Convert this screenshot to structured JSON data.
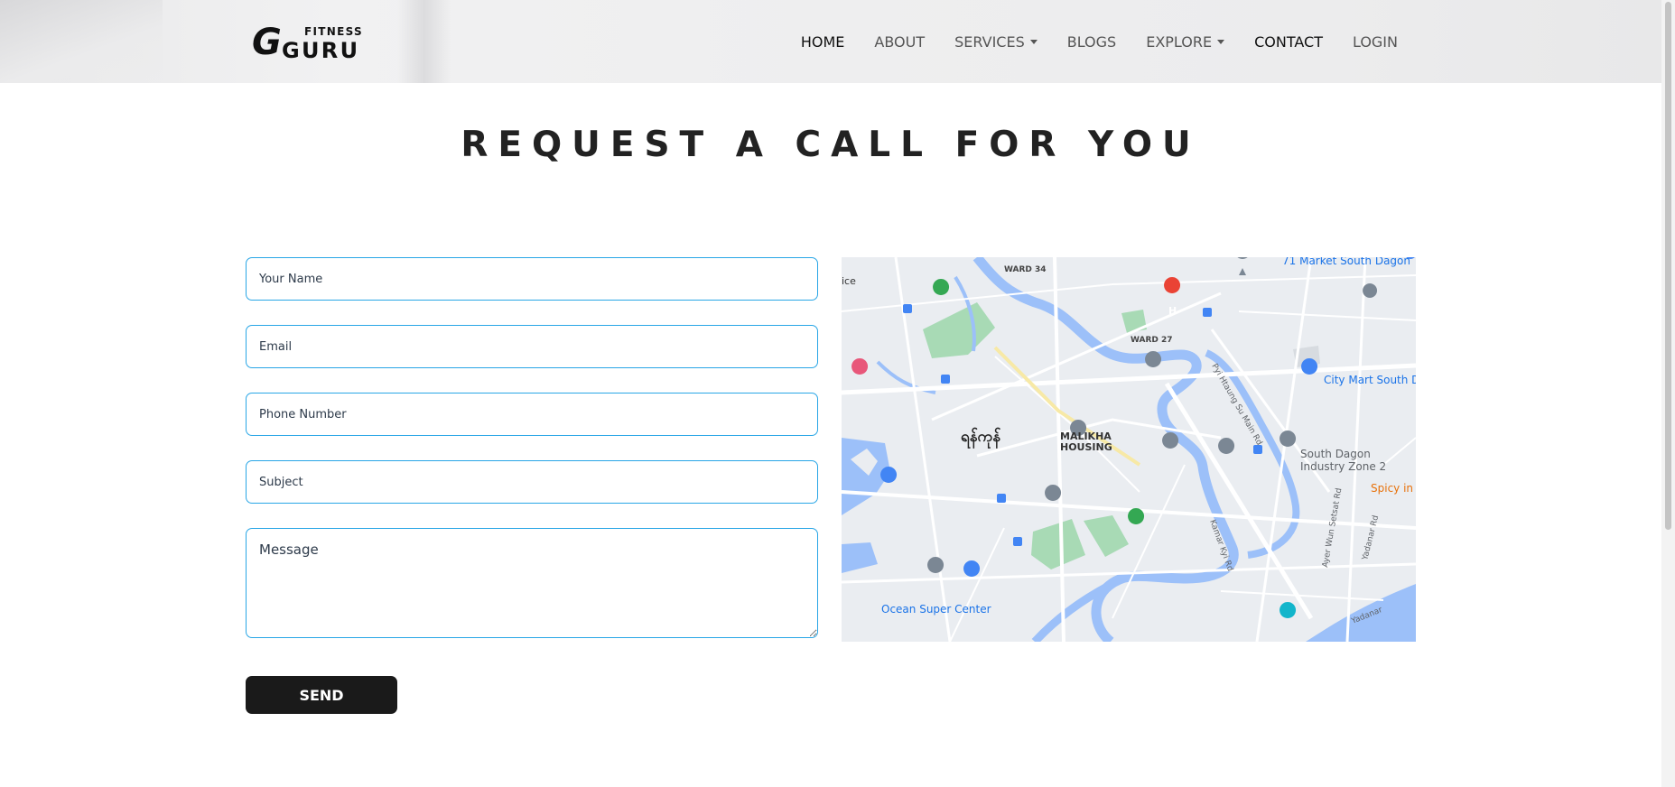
{
  "brand": {
    "logo_big": "GURU",
    "logo_small": "FITNESS"
  },
  "nav": {
    "items": [
      {
        "label": "HOME"
      },
      {
        "label": "ABOUT"
      },
      {
        "label": "SERVICES"
      },
      {
        "label": "BLOGS"
      },
      {
        "label": "EXPLORE"
      },
      {
        "label": "CONTACT"
      },
      {
        "label": "LOGIN"
      }
    ]
  },
  "page": {
    "title": "REQUEST A CALL FOR YOU"
  },
  "form": {
    "name_placeholder": "Your Name",
    "email_placeholder": "Email",
    "phone_placeholder": "Phone Number",
    "subject_placeholder": "Subject",
    "message_placeholder": "Message",
    "send_label": "SEND"
  },
  "map": {
    "labels": {
      "market": "71 Market South Dagon",
      "ward34": "WARD 34",
      "ward27": "WARD 27",
      "malikha": "MALIKHA",
      "housing": "HOUSING",
      "city_mart": "City Mart South D",
      "south_dagon": "South Dagon",
      "industry": "Industry Zone 2",
      "spicy": "Spicy in",
      "ocean": "Ocean Super Center",
      "pyi_htaung": "Pyi Htaung Su Main Rd",
      "kamar_kyi": "Kamar Kyi Rd",
      "ayer_wun": "Ayer Wun Setsat Rd",
      "yadanar_rd": "Yadanar Rd",
      "yadanar": "Yadanar",
      "ice": "ice",
      "yangon": "ရန်ကုန်"
    },
    "colors": {
      "water": "#9cc0f9",
      "park": "#a8dab5",
      "land": "#eaedf1",
      "road": "#ffffff",
      "label_blue": "#1a73e8",
      "label_orange": "#e8710a"
    }
  }
}
